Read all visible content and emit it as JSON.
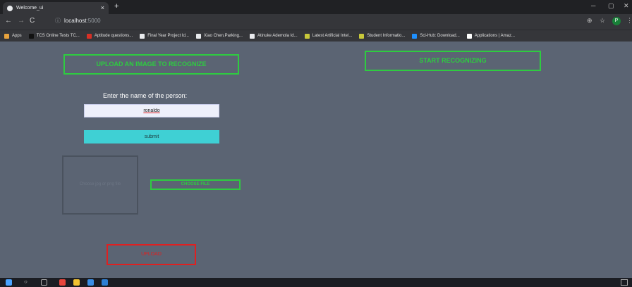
{
  "browser": {
    "tab_title": "Welcome_ui",
    "tab_close": "×",
    "new_tab": "+",
    "url_host": "localhost",
    "url_port": ":5000",
    "profile_initial": "P",
    "bookmarks": [
      {
        "label": "Apps",
        "color": "#e8a33d"
      },
      {
        "label": "TCS Online Tests TC...",
        "color": "#111111"
      },
      {
        "label": "Aptitude questions...",
        "color": "#d93025"
      },
      {
        "label": "Final Year Project Id...",
        "color": "#e8eaed"
      },
      {
        "label": "Xiao Chen,Parking...",
        "color": "#e8eaed"
      },
      {
        "label": "Atinuke Ademola Id...",
        "color": "#e8eaed"
      },
      {
        "label": "Latest Artificial Intel...",
        "color": "#c8c83a"
      },
      {
        "label": "Student Informatio...",
        "color": "#c8c83a"
      },
      {
        "label": "Sci-Hub: Download...",
        "color": "#1e90ff"
      },
      {
        "label": "Applications | Amaz...",
        "color": "#ffffff"
      }
    ]
  },
  "page": {
    "upload_recognize_label": "UPLOAD AN IMAGE TO RECOGNIZE",
    "start_recognizing_label": "START RECOGNIZING",
    "enter_name_label": "Enter the name of the person:",
    "name_value": "ronaldo",
    "submit_label": "submit",
    "drop_placeholder": "Choose jpg or png file",
    "choose_file_label": "CHOOSE FILE",
    "upload_label": "UPLOAD"
  },
  "colors": {
    "accent_green": "#2ecc40",
    "submit_cyan": "#3fd0d4",
    "upload_red": "#e02020",
    "page_bg": "#5b6473"
  }
}
